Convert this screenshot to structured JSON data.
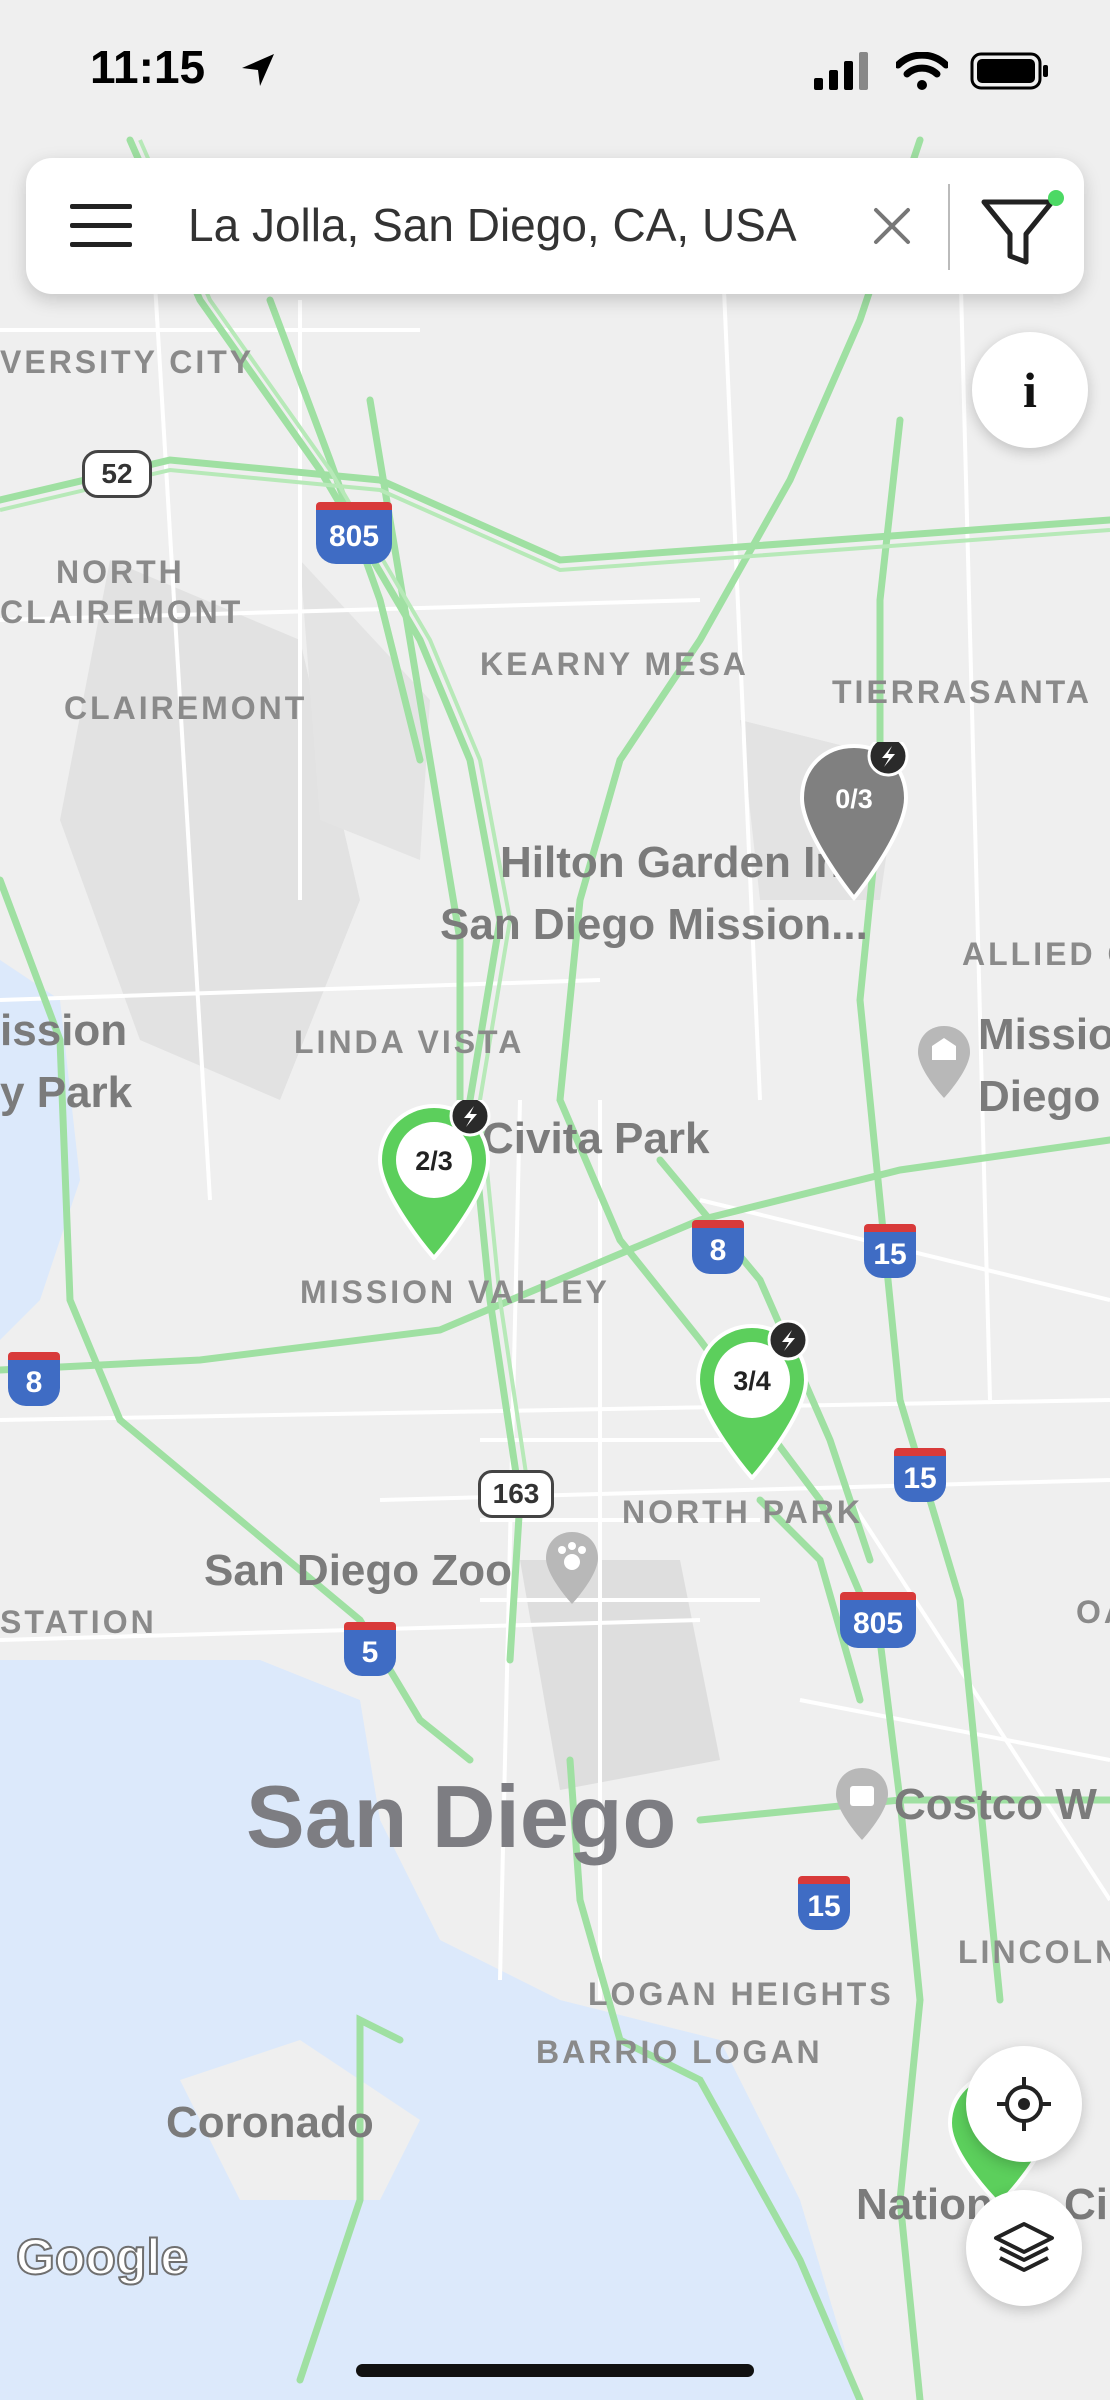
{
  "status_bar": {
    "time": "11:15"
  },
  "search": {
    "value": "La Jolla, San Diego, CA, USA"
  },
  "map": {
    "areas": [
      "VERSITY CITY",
      "NORTH",
      "CLAIREMONT",
      "CLAIREMONT",
      "KEARNY MESA",
      "TIERRASANTA",
      "LINDA VISTA",
      "MISSION VALLEY",
      "NORTH PARK",
      "STATION",
      "LOGAN HEIGHTS",
      "BARRIO LOGAN",
      "ALLIED G",
      "LINCOLN",
      "OA"
    ],
    "places": [
      "Hilton Garden Inn",
      "San Diego Mission...",
      "Civita Park",
      "San Diego Zoo",
      "Costco W",
      "Coronado",
      "Nation",
      "Ci",
      "Missio",
      "Diego",
      "ission",
      "y Park"
    ],
    "city": "San Diego",
    "shields": [
      "52",
      "805",
      "8",
      "15",
      "15",
      "163",
      "5",
      "805",
      "8",
      "15"
    ],
    "pins": [
      {
        "label": "0/3",
        "color": "#808080"
      },
      {
        "label": "2/3",
        "color": "#5ccf5c"
      },
      {
        "label": "3/4",
        "color": "#5ccf5c"
      }
    ],
    "attribution": "Google",
    "colors": {
      "highway": "#9fe0a2",
      "water": "#dce9fb",
      "land": "#efefef"
    }
  }
}
